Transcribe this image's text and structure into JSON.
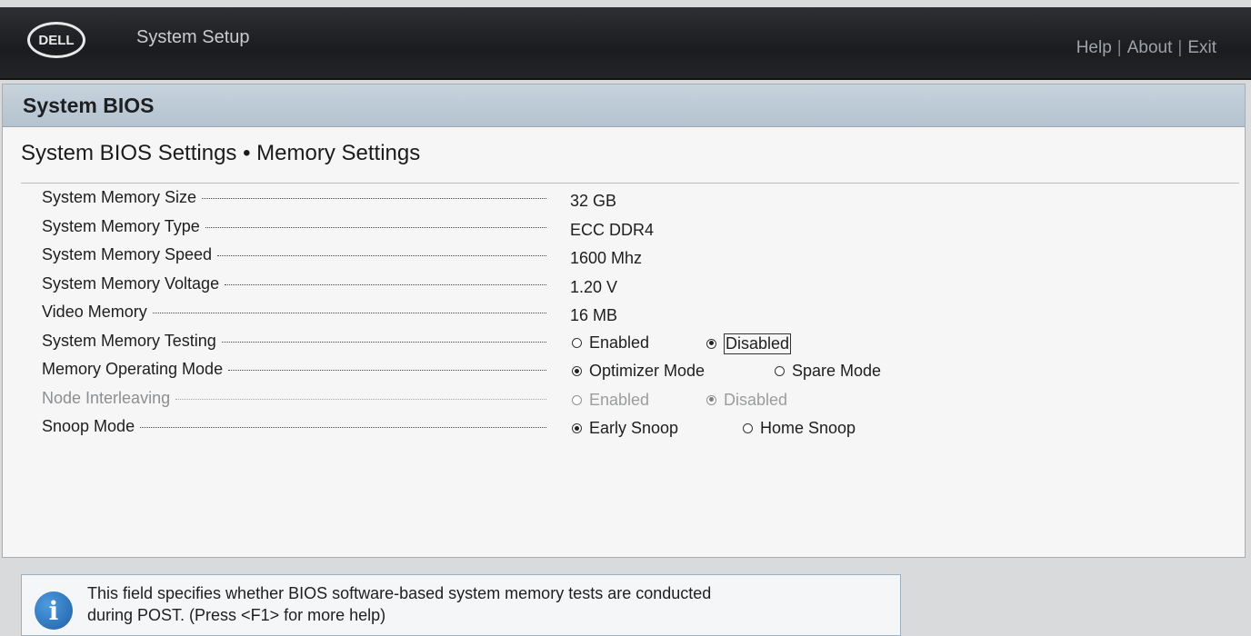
{
  "header": {
    "logo_text": "DELL",
    "app_title": "System Setup",
    "links": {
      "help": "Help",
      "about": "About",
      "exit": "Exit"
    },
    "separator": "|"
  },
  "panel": {
    "title": "System BIOS",
    "breadcrumb": "System BIOS Settings • Memory Settings"
  },
  "settings": {
    "memory_size": {
      "label": "System Memory Size",
      "value": "32 GB"
    },
    "memory_type": {
      "label": "System Memory Type",
      "value": "ECC DDR4"
    },
    "memory_speed": {
      "label": "System Memory Speed",
      "value": "1600 Mhz"
    },
    "memory_voltage": {
      "label": "System Memory Voltage",
      "value": "1.20 V"
    },
    "video_memory": {
      "label": "Video Memory",
      "value": "16 MB"
    },
    "memory_testing": {
      "label": "System Memory Testing",
      "options": [
        "Enabled",
        "Disabled"
      ],
      "selected": "Disabled"
    },
    "operating_mode": {
      "label": "Memory Operating Mode",
      "options": [
        "Optimizer Mode",
        "Spare Mode"
      ],
      "selected": "Optimizer Mode"
    },
    "node_interleaving": {
      "label": "Node Interleaving",
      "options": [
        "Enabled",
        "Disabled"
      ],
      "selected": "Disabled",
      "disabled": true
    },
    "snoop_mode": {
      "label": "Snoop Mode",
      "options": [
        "Early Snoop",
        "Home Snoop"
      ],
      "selected": "Early Snoop"
    }
  },
  "help": {
    "icon": "info-icon",
    "line1": "This field specifies whether BIOS software-based system memory tests are conducted",
    "line2": "during POST. (Press <F1> for more help)"
  }
}
